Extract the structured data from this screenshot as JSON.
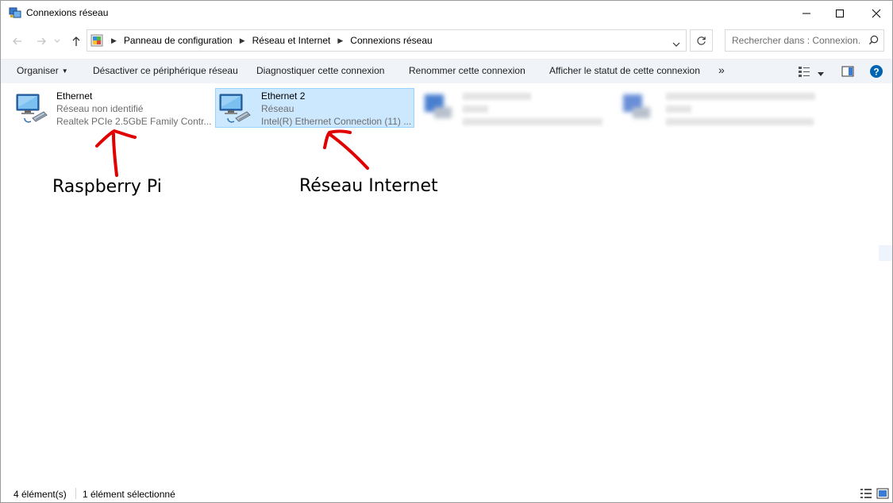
{
  "window": {
    "title": "Connexions réseau"
  },
  "address": {
    "crumbs": [
      "Panneau de configuration",
      "Réseau et Internet",
      "Connexions réseau"
    ],
    "search_placeholder": "Rechercher dans : Connexion..."
  },
  "toolbar": {
    "organize_label": "Organiser",
    "disable_label": "Désactiver ce périphérique réseau",
    "diagnose_label": "Diagnostiquer cette connexion",
    "rename_label": "Renommer cette connexion",
    "status_label": "Afficher le statut de cette connexion",
    "more_label": "»"
  },
  "items": [
    {
      "name": "Ethernet",
      "network": "Réseau non identifié",
      "adapter": "Realtek PCIe 2.5GbE Family Contr...",
      "selected": false
    },
    {
      "name": "Ethernet 2",
      "network": "Réseau",
      "adapter": "Intel(R) Ethernet Connection (11) ...",
      "selected": true
    }
  ],
  "annotations": {
    "left": "Raspberry Pi",
    "right": "Réseau Internet",
    "color": "#e00000"
  },
  "status": {
    "count": "4 élément(s)",
    "selected": "1 élément sélectionné"
  },
  "colors": {
    "selection_bg": "#cce8ff",
    "selection_border": "#99d1ff",
    "help_blue": "#0063b1",
    "cmdbar_bg": "#f0f3f8"
  }
}
